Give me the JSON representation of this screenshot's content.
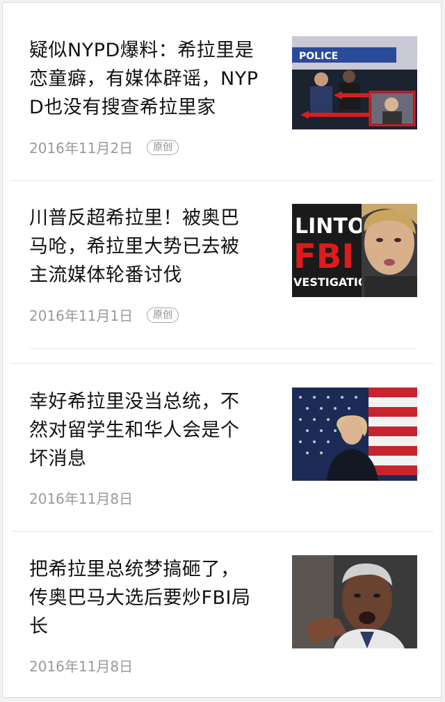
{
  "articles": [
    {
      "title": "疑似NYPD爆料：希拉里是\n恋童癖，有媒体辟谣，NYP\nD也没有搜查希拉里家",
      "date": "2016年11月2日",
      "badge": "原创",
      "thumb": {
        "text": "POLICE",
        "colors": [
          "#1b2a4a",
          "#d21f1f",
          "#c9c9d6"
        ]
      }
    },
    {
      "title": "川普反超希拉里！被奥巴\n马呛，希拉里大势已去被\n主流媒体轮番讨伐",
      "date": "2016年11月1日",
      "badge": "原创",
      "thumb": {
        "lines": [
          "LINTON",
          "FBI",
          "VESTIGATION"
        ],
        "colors": [
          "#1a1a1a",
          "#e01a1a",
          "#ffffff"
        ]
      }
    },
    {
      "title": "幸好希拉里没当总统，不\n然对留学生和华人会是个\n坏消息",
      "date": "2016年11月8日",
      "badge": "",
      "thumb": {
        "colors": [
          "#1c2b56",
          "#c8242d",
          "#f2f2f2"
        ]
      }
    },
    {
      "title": "把希拉里总统梦搞砸了，\n传奥巴马大选后要炒FBI局\n长",
      "date": "2016年11月8日",
      "badge": "",
      "thumb": {
        "colors": [
          "#2a2a2a",
          "#5a3a2a",
          "#e8e8e8"
        ]
      }
    }
  ]
}
